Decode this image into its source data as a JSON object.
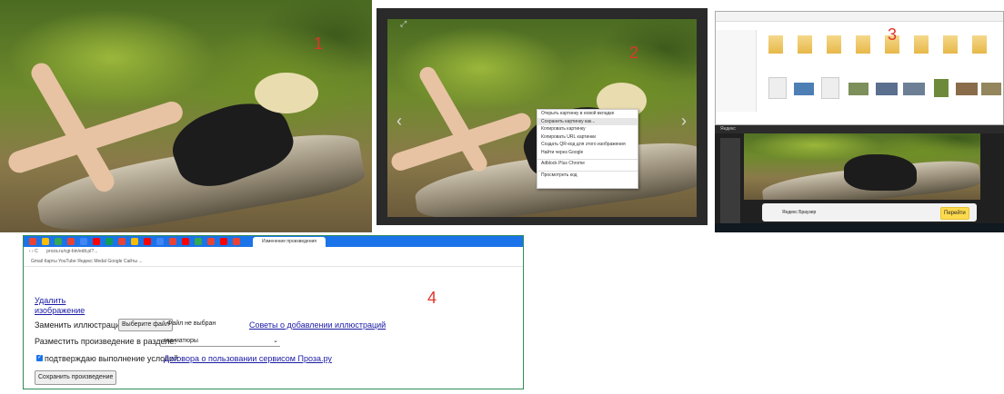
{
  "labels": {
    "p1": "1",
    "p2": "2",
    "p3": "3",
    "p4": "4"
  },
  "viewer": {
    "prev_glyph": "‹",
    "next_glyph": "›",
    "context_menu": [
      "Открыть картинку в новой вкладке",
      "Сохранить картинку как...",
      "Копировать картинку",
      "Копировать URL картинки",
      "Создать QR-код для этого изображения",
      "Найти через Google",
      "",
      "Adblock Plus Chrome",
      "",
      "Просмотреть код"
    ]
  },
  "explorer": {
    "bar_text": "Яндекс",
    "title": "Яндекс Браузер",
    "banner_button": "Перейти"
  },
  "browser": {
    "tab_title": "Изменение произведения",
    "url": "proza.ru/cgi-bin/edit.pl?...",
    "bookmarks": "Gmail   Карты   YouTube   Яндекс   Medal   Google   Сайты   ...",
    "delete_link": "Удалить",
    "image_link": "изображение",
    "replace_label": "Заменить иллюстрацию:",
    "choose_file_button": "Выберите файл",
    "no_file_text": "Файл не выбран",
    "help_link": "Советы о добавлении иллюстраций",
    "section_label": "Разместить произведение в разделе:",
    "section_value": "- миниатюры",
    "agree_text": "подтверждаю выполнение условий",
    "agree_link": "Договора о пользовании сервисом Проза.ру",
    "save_button": "Сохранить произведение"
  }
}
